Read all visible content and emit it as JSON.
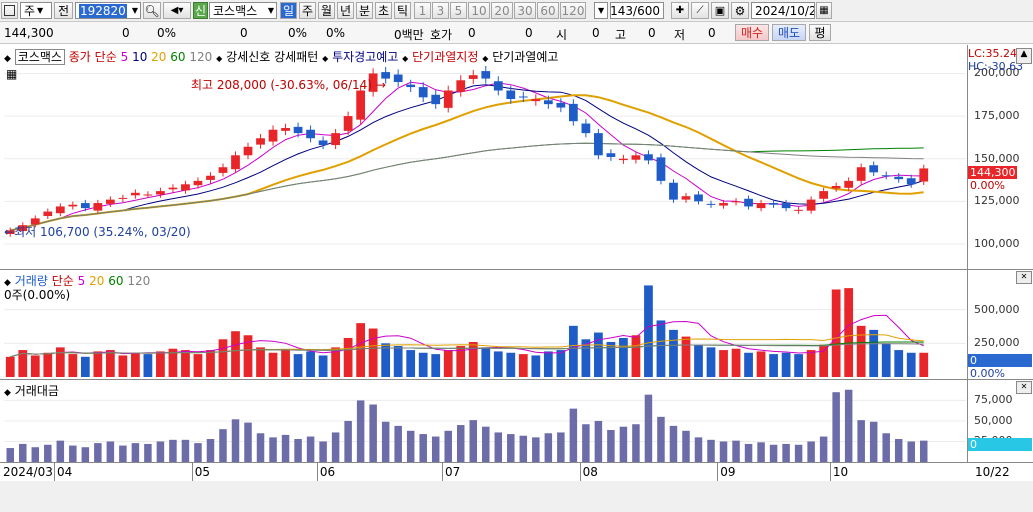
{
  "toolbar": {
    "market_type": "주",
    "tab_jeon": "전",
    "stock_code": "192820",
    "new_badge": "신",
    "stock_name": "코스맥스",
    "periods": [
      "일",
      "주",
      "월",
      "년",
      "분",
      "초",
      "틱"
    ],
    "active_period": "일",
    "intervals": [
      "1",
      "3",
      "5",
      "10",
      "20",
      "30",
      "60",
      "120"
    ],
    "count": "143/600",
    "date": "2024/10/22"
  },
  "infobar": {
    "price": "144,300",
    "change": "0",
    "change_rate": "0%",
    "volume": "0",
    "volume_rate": "0%",
    "amount_rate": "0%",
    "amount": "0백만",
    "hoga_label": "호가",
    "hoga_value": "0",
    "open_label": "시",
    "open_value": "0",
    "high_label": "고",
    "high_value": "0",
    "low_label": "저",
    "low_value": "0",
    "buy_label": "매수",
    "sell_label": "매도",
    "avg_label": "평"
  },
  "price_panel": {
    "legend": {
      "name": "코스맥스",
      "close_label": "종가",
      "sma_label": "단순",
      "ma_periods": [
        "5",
        "10",
        "20",
        "60",
        "120"
      ],
      "ma_colors": [
        "#cc00cc",
        "#000080",
        "#e0a000",
        "#008000",
        "#808080"
      ],
      "tag1": "강세신호 강세패턴",
      "tag2": "투자경고예고",
      "tag3": "단기과열지정",
      "tag4": "단기과열예고"
    },
    "lc": "LC:35.24",
    "hc": "HC:-30.63",
    "high_note": "최고 208,000 (-30.63%, 06/14)",
    "low_note": "최저 106,700 (35.24%, 03/20)",
    "last_price_label": "144,300",
    "last_rate_label": "0.00%",
    "yaxis_labels": [
      "200,000",
      "175,000",
      "150,000",
      "125,000",
      "100,000"
    ]
  },
  "volume_panel": {
    "legend": {
      "title": "거래량",
      "sma_label": "단순",
      "ma_periods": [
        "5",
        "20",
        "60",
        "120"
      ]
    },
    "current": "0주(0.00%)",
    "last_label": "0",
    "last_rate": "0.00%",
    "yaxis_labels": [
      "500,000",
      "250,000",
      "0"
    ]
  },
  "amount_panel": {
    "title": "거래대금",
    "last_label": "0",
    "yaxis_labels": [
      "75,000",
      "50,000",
      "25,000",
      "0"
    ]
  },
  "xaxis": {
    "start": "2024/03",
    "months": [
      "04",
      "05",
      "06",
      "07",
      "08",
      "09",
      "10"
    ],
    "end": "10/22"
  },
  "colors": {
    "up": "#e8262a",
    "down": "#1f5cc8",
    "amount_bar": "#6c6ca8",
    "highlight": "#2a6ad0"
  },
  "chart_data": [
    {
      "type": "candlestick",
      "title": "코스맥스",
      "x": [
        "03/20",
        "03/22",
        "03/26",
        "03/28",
        "04/01",
        "04/03",
        "04/05",
        "04/09",
        "04/11",
        "04/15",
        "04/17",
        "04/19",
        "04/23",
        "04/25",
        "04/29",
        "05/02",
        "05/06",
        "05/09",
        "05/13",
        "05/16",
        "05/20",
        "05/22",
        "05/24",
        "05/28",
        "05/30",
        "06/03",
        "06/05",
        "06/10",
        "06/12",
        "06/14",
        "06/18",
        "06/20",
        "06/24",
        "06/26",
        "06/28",
        "07/02",
        "07/04",
        "07/08",
        "07/10",
        "07/12",
        "07/16",
        "07/18",
        "07/22",
        "07/24",
        "07/26",
        "07/30",
        "08/01",
        "08/05",
        "08/07",
        "08/09",
        "08/13",
        "08/16",
        "08/20",
        "08/22",
        "08/26",
        "08/28",
        "08/30",
        "09/03",
        "09/05",
        "09/09",
        "09/11",
        "09/13",
        "09/19",
        "09/23",
        "09/25",
        "09/27",
        "10/02",
        "10/04",
        "10/08",
        "10/10",
        "10/14",
        "10/16",
        "10/18",
        "10/22"
      ],
      "close": [
        108000,
        111000,
        115000,
        119000,
        122000,
        123000,
        121000,
        124000,
        126000,
        127000,
        130000,
        129000,
        131000,
        133000,
        135000,
        137000,
        140000,
        145000,
        152000,
        157000,
        162000,
        167000,
        168000,
        165000,
        162000,
        158000,
        165000,
        175000,
        190000,
        200000,
        197000,
        195000,
        192000,
        186000,
        182000,
        190000,
        196000,
        199000,
        197000,
        190000,
        185000,
        186000,
        185000,
        182000,
        180000,
        172000,
        165000,
        152000,
        151000,
        150000,
        152000,
        149000,
        137000,
        126000,
        128000,
        125000,
        123000,
        124000,
        125000,
        122000,
        124000,
        123000,
        121000,
        120000,
        126000,
        131000,
        134000,
        137000,
        145000,
        142000,
        140000,
        138000,
        135000,
        144300
      ],
      "yaxis_range": [
        90000,
        212000
      ],
      "moving_averages": [
        "5",
        "10",
        "20",
        "60",
        "120"
      ]
    },
    {
      "type": "bar",
      "title": "거래량",
      "x": [
        "03/20",
        "03/22",
        "03/26",
        "03/28",
        "04/01",
        "04/03",
        "04/05",
        "04/09",
        "04/11",
        "04/15",
        "04/17",
        "04/19",
        "04/23",
        "04/25",
        "04/29",
        "05/02",
        "05/06",
        "05/09",
        "05/13",
        "05/16",
        "05/20",
        "05/22",
        "05/24",
        "05/28",
        "05/30",
        "06/03",
        "06/05",
        "06/10",
        "06/12",
        "06/14",
        "06/18",
        "06/20",
        "06/24",
        "06/26",
        "06/28",
        "07/02",
        "07/04",
        "07/08",
        "07/10",
        "07/12",
        "07/16",
        "07/18",
        "07/22",
        "07/24",
        "07/26",
        "07/30",
        "08/01",
        "08/05",
        "08/07",
        "08/09",
        "08/13",
        "08/16",
        "08/20",
        "08/22",
        "08/26",
        "08/28",
        "08/30",
        "09/03",
        "09/05",
        "09/09",
        "09/11",
        "09/13",
        "09/19",
        "09/23",
        "09/25",
        "09/27",
        "10/02",
        "10/04",
        "10/08",
        "10/10",
        "10/14",
        "10/16",
        "10/18",
        "10/22"
      ],
      "values": [
        150000,
        200000,
        160000,
        180000,
        220000,
        170000,
        150000,
        190000,
        200000,
        160000,
        180000,
        170000,
        190000,
        210000,
        200000,
        170000,
        200000,
        280000,
        340000,
        310000,
        220000,
        180000,
        200000,
        170000,
        190000,
        160000,
        220000,
        290000,
        400000,
        360000,
        250000,
        230000,
        200000,
        180000,
        170000,
        200000,
        230000,
        260000,
        220000,
        190000,
        180000,
        170000,
        160000,
        190000,
        200000,
        380000,
        280000,
        330000,
        260000,
        290000,
        310000,
        680000,
        420000,
        350000,
        300000,
        240000,
        220000,
        200000,
        210000,
        180000,
        190000,
        170000,
        180000,
        170000,
        200000,
        240000,
        650000,
        660000,
        380000,
        350000,
        250000,
        200000,
        180000,
        180000
      ],
      "yaxis_range": [
        0,
        750000
      ]
    },
    {
      "type": "bar",
      "title": "거래대금",
      "x": [
        "03/20",
        "03/22",
        "03/26",
        "03/28",
        "04/01",
        "04/03",
        "04/05",
        "04/09",
        "04/11",
        "04/15",
        "04/17",
        "04/19",
        "04/23",
        "04/25",
        "04/29",
        "05/02",
        "05/06",
        "05/09",
        "05/13",
        "05/16",
        "05/20",
        "05/22",
        "05/24",
        "05/28",
        "05/30",
        "06/03",
        "06/05",
        "06/10",
        "06/12",
        "06/14",
        "06/18",
        "06/20",
        "06/24",
        "06/26",
        "06/28",
        "07/02",
        "07/04",
        "07/08",
        "07/10",
        "07/12",
        "07/16",
        "07/18",
        "07/22",
        "07/24",
        "07/26",
        "07/30",
        "08/01",
        "08/05",
        "08/07",
        "08/09",
        "08/13",
        "08/16",
        "08/20",
        "08/22",
        "08/26",
        "08/28",
        "08/30",
        "09/03",
        "09/05",
        "09/09",
        "09/11",
        "09/13",
        "09/19",
        "09/23",
        "09/25",
        "09/27",
        "10/02",
        "10/04",
        "10/08",
        "10/10",
        "10/14",
        "10/16",
        "10/18",
        "10/22"
      ],
      "values": [
        17000,
        22000,
        18000,
        21000,
        26000,
        20000,
        18000,
        23000,
        25000,
        20000,
        23000,
        22000,
        25000,
        27000,
        27000,
        23000,
        28000,
        40000,
        52000,
        48000,
        35000,
        30000,
        33000,
        28000,
        31000,
        25000,
        36000,
        50000,
        75000,
        70000,
        49000,
        44000,
        38000,
        34000,
        31000,
        38000,
        45000,
        51000,
        43000,
        36000,
        34000,
        32000,
        30000,
        35000,
        36000,
        65000,
        46000,
        50000,
        39000,
        43000,
        46000,
        82000,
        55000,
        44000,
        38000,
        30000,
        27000,
        25000,
        26000,
        22000,
        24000,
        21000,
        22000,
        21000,
        25000,
        31000,
        85000,
        88000,
        51000,
        49000,
        35000,
        28000,
        25000,
        26000
      ],
      "yaxis_range": [
        0,
        95000
      ]
    }
  ]
}
